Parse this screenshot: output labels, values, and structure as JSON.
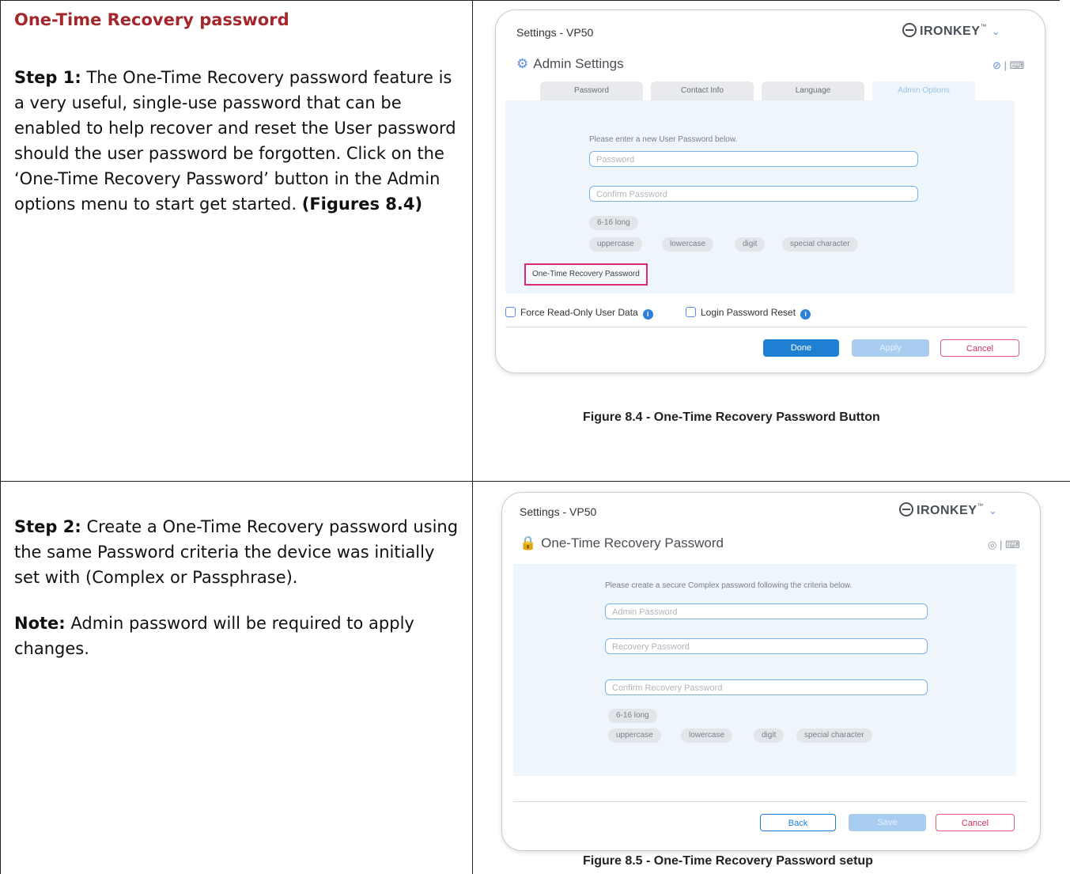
{
  "section_title": "One-Time Recovery password",
  "step1": {
    "label": "Step 1:",
    "text": " The One-Time Recovery password feature is a very useful, single-use password that can be enabled to help recover and reset the User password should the user password be forgotten.  Click on the ‘One-Time Recovery Password’ button in the Admin options menu to start get started. ",
    "figref": "(Figures 8.4)"
  },
  "step2": {
    "label": "Step 2:",
    "text": " Create a One-Time Recovery password using the same Password criteria the device was initially set with (Complex or Passphrase)."
  },
  "note": {
    "label": "Note:",
    "text": " Admin password will be required to apply changes."
  },
  "brand": {
    "name": "IRONKEY",
    "tm": "™",
    "chevron": "⌄"
  },
  "fig1": {
    "window_title": "Settings - VP50",
    "panel_title": "Admin Settings",
    "tabs": [
      "Password",
      "Contact Info",
      "Language",
      "Admin Options"
    ],
    "hint": "Please enter a new User Password below.",
    "password_placeholder": "Password",
    "confirm_placeholder": "Confirm Password",
    "length_chip": "6-16 long",
    "chips": [
      "uppercase",
      "lowercase",
      "digit",
      "special character"
    ],
    "otr_button": "One-Time Recovery Password",
    "checkbox1": "Force Read-Only User Data",
    "checkbox2": "Login Password Reset",
    "done": "Done",
    "apply": "Apply",
    "cancel": "Cancel",
    "caption": "Figure 8.4 - One-Time Recovery Password Button"
  },
  "fig2": {
    "window_title": "Settings - VP50",
    "panel_title": "One-Time Recovery Password",
    "hint": "Please create a secure Complex password following the criteria below.",
    "admin_placeholder": "Admin Password",
    "recovery_placeholder": "Recovery Password",
    "confirm_placeholder": "Confirm Recovery Password",
    "length_chip": "6-16 long",
    "chips": [
      "uppercase",
      "lowercase",
      "digit",
      "special character"
    ],
    "back": "Back",
    "save": "Save",
    "cancel": "Cancel",
    "caption": "Figure 8.5 - One-Time Recovery Password setup"
  },
  "colors": {
    "title_red": "#a3272b",
    "accent_blue": "#1f7fd3",
    "highlight_pink": "#e0287a"
  }
}
